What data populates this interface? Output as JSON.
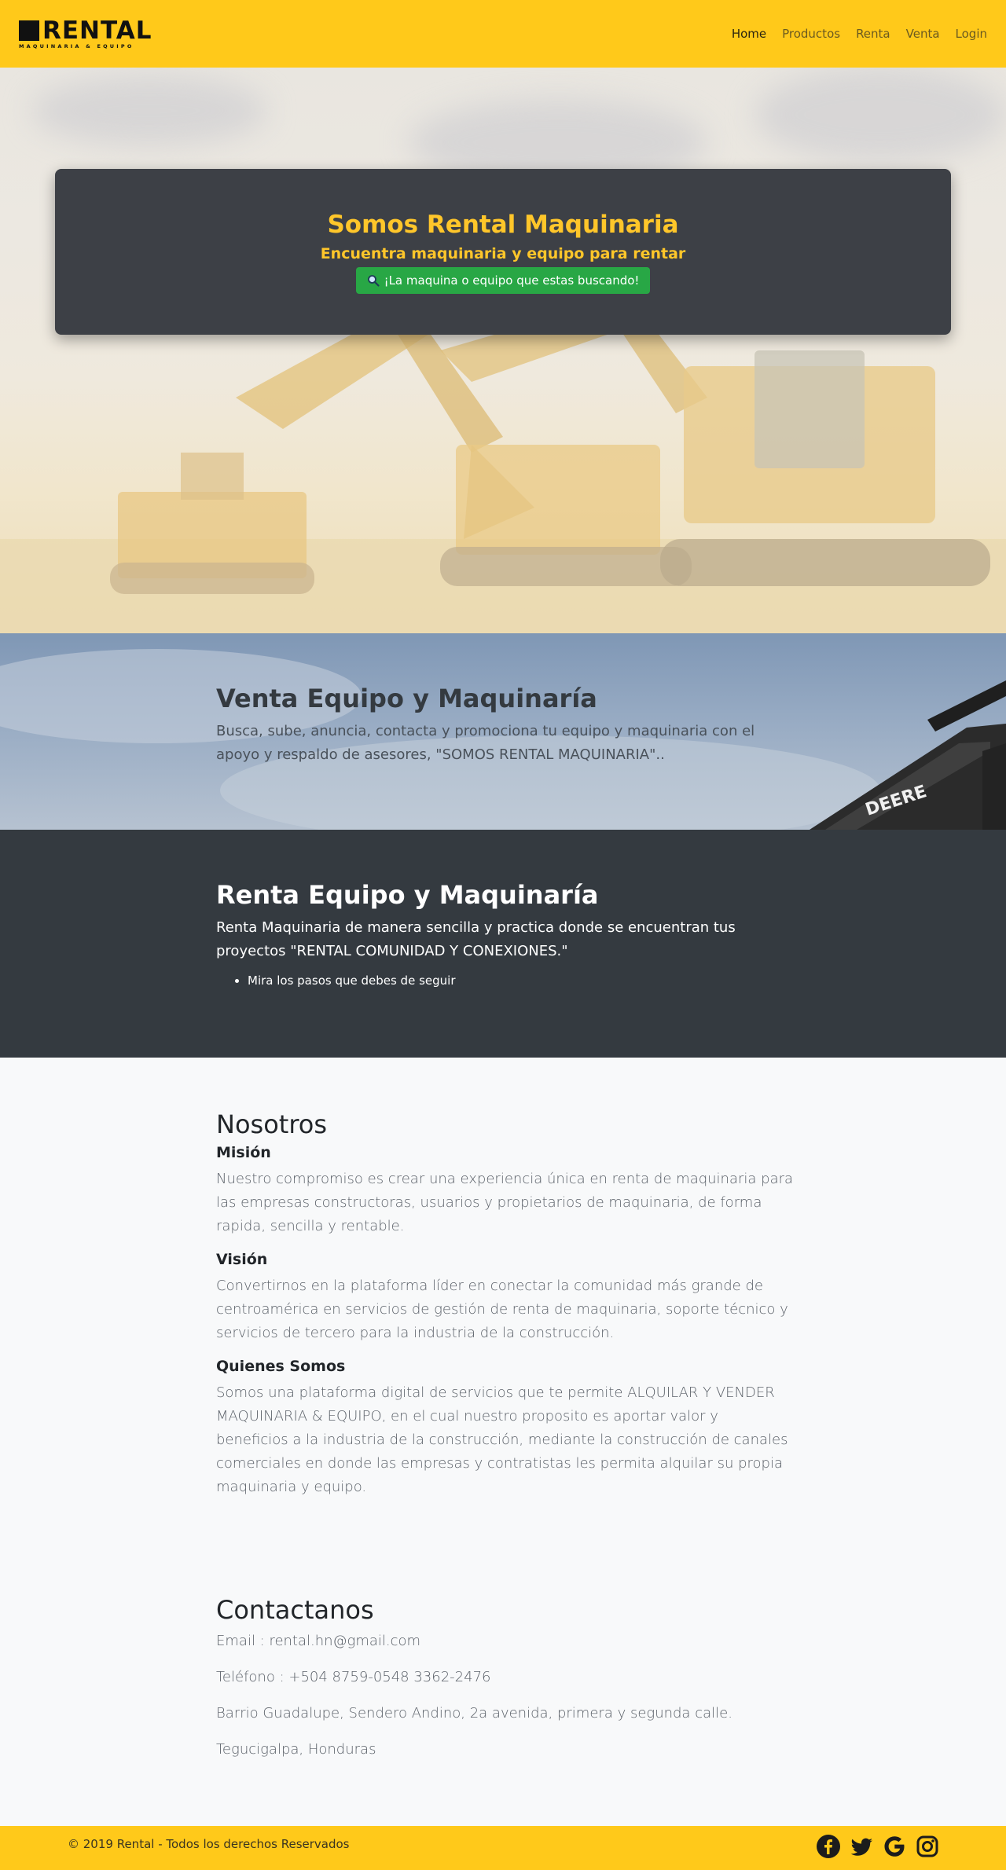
{
  "brand": {
    "name": "RENTAL",
    "tagline": "MAQUINARIA & EQUIPO"
  },
  "nav": {
    "items": [
      {
        "label": "Home",
        "active": true
      },
      {
        "label": "Productos",
        "active": false
      },
      {
        "label": "Renta",
        "active": false
      },
      {
        "label": "Venta",
        "active": false
      },
      {
        "label": "Login",
        "active": false
      }
    ]
  },
  "hero": {
    "title": "Somos Rental Maquinaria",
    "subtitle": "Encuentra maquinaria y equipo para rentar",
    "button_label": "¡La maquina o equipo que estas buscando!",
    "button_icon": "search-icon"
  },
  "venta": {
    "title": "Venta Equipo y Maquinaría",
    "text": "Busca, sube, anuncia, contacta y promociona tu equipo y maquinaria con el apoyo y respaldo de asesores, \"SOMOS RENTAL MAQUINARIA\".."
  },
  "renta": {
    "title": "Renta Equipo y Maquinaría",
    "text": "Renta Maquinaria de manera sencilla y practica donde se encuentran tus proyectos \"RENTAL COMUNIDAD Y CONEXIONES.\"",
    "list": [
      "Mira los pasos que debes de seguir"
    ]
  },
  "nosotros": {
    "title": "Nosotros",
    "mision_title": "Misión",
    "mision_text": "Nuestro compromiso es crear una experiencia única en renta de maquinaria para las empresas constructoras, usuarios y propietarios de maquinaria, de forma rapida, sencilla y rentable.",
    "vision_title": "Visión",
    "vision_text": "Convertirnos en la plataforma líder en conectar la comunidad más grande de centroamérica en servicios de gestión de renta de maquinaria, soporte técnico y servicios de tercero para la industria de la construcción.",
    "quienes_title": "Quienes Somos",
    "quienes_text": "Somos una plataforma digital de servicios que te permite ALQUILAR Y VENDER MAQUINARIA & EQUIPO, en el cual nuestro proposito es aportar valor y beneficios a la industria de la construcción, mediante la construcción de canales comerciales en donde las empresas y contratistas les permita alquilar su propia maquinaria y equipo."
  },
  "contact": {
    "title": "Contactanos",
    "email": "Email : rental.hn@gmail.com",
    "phone": "Teléfono : +504 8759-0548 3362-2476",
    "address": "Barrio Guadalupe, Sendero Andino, 2a avenida, primera y segunda calle.",
    "city": "Tegucigalpa, Honduras"
  },
  "footer": {
    "copyright": "© 2019 Rental - Todos los derechos Reservados",
    "social": [
      "facebook-icon",
      "twitter-icon",
      "google-icon",
      "instagram-icon"
    ]
  },
  "decor": {
    "excavator_brand": "DEERE"
  },
  "colors": {
    "brand_yellow": "#ffc91a",
    "hero_title": "#ffc62a",
    "dark": "#343a40",
    "success": "#28a745"
  }
}
